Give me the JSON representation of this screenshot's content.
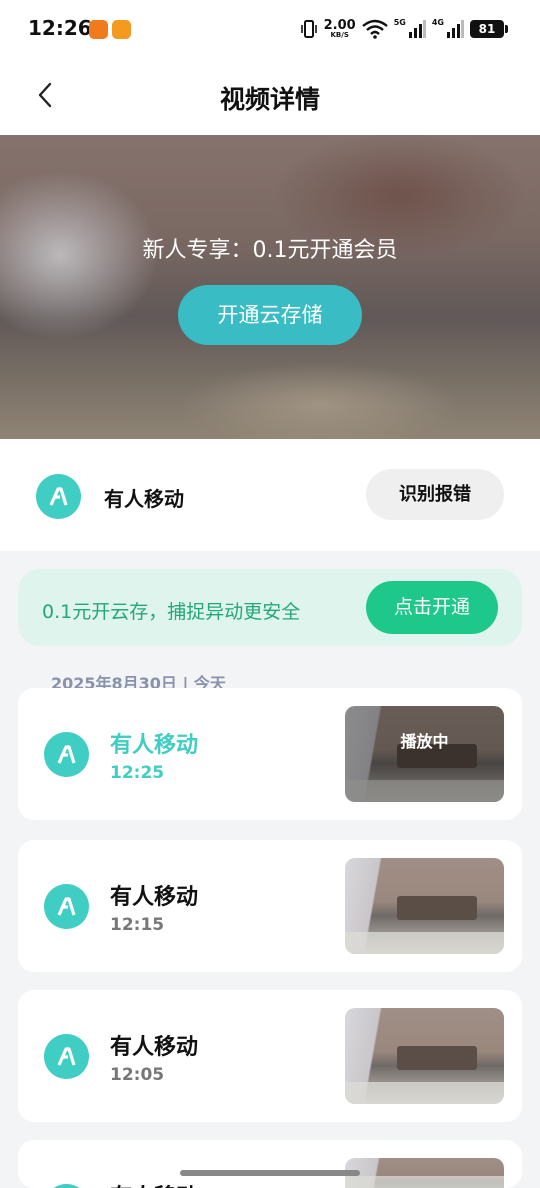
{
  "status_bar": {
    "time": "12:26",
    "net_speed": "2.00",
    "net_unit": "KB/S",
    "gen_5g": "5G",
    "gen_4g": "4G",
    "battery": "81"
  },
  "header": {
    "title": "视频详情"
  },
  "hero": {
    "promo_text": "新人专享：0.1元开通会员",
    "button_label": "开通云存储"
  },
  "event": {
    "title": "有人移动",
    "report_label": "识别报错"
  },
  "cloud_banner": {
    "text": "0.1元开云存，捕捉异动更安全",
    "button_label": "点击开通"
  },
  "date_header": "2025年8月30日 | 今天",
  "list": [
    {
      "title": "有人移动",
      "time": "12:25",
      "status": "播放中",
      "active": true
    },
    {
      "title": "有人移动",
      "time": "12:15",
      "active": false
    },
    {
      "title": "有人移动",
      "time": "12:05",
      "active": false
    },
    {
      "title": "有人移动",
      "time": "",
      "active": false
    }
  ],
  "colors": {
    "accent": "#3fcdc4",
    "cloud_green": "#1dc88a",
    "hero_button": "#39bcc4"
  },
  "icons": {
    "back": "chevron-left-icon",
    "motion": "person-walking-icon"
  }
}
